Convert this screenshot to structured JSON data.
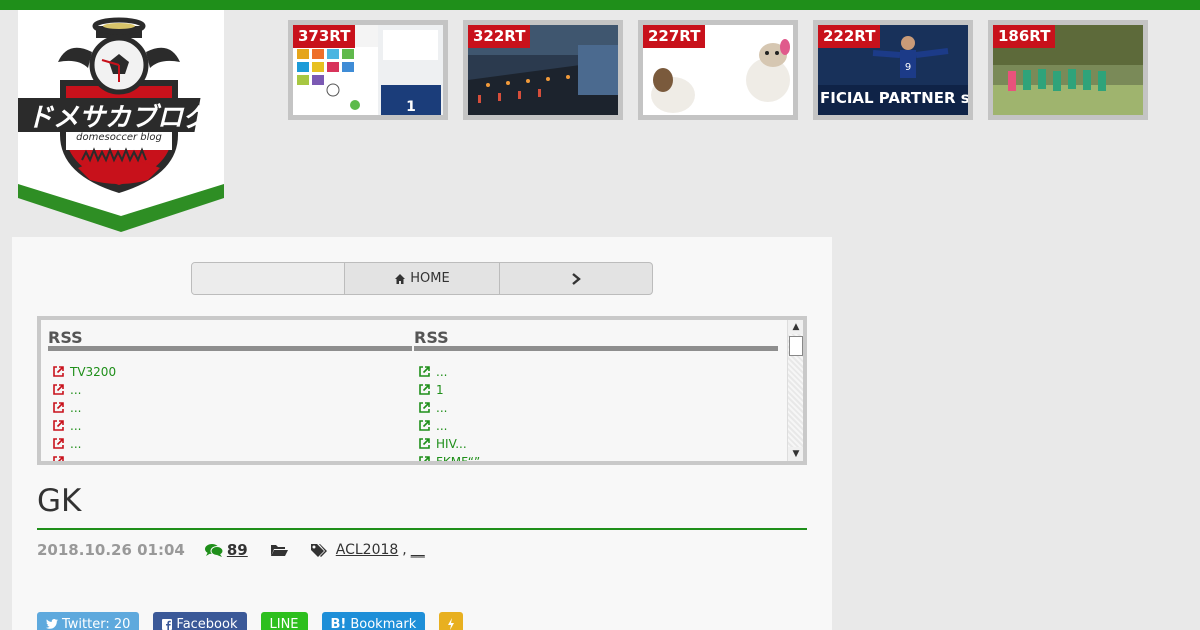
{
  "brand": {
    "logo_text": "ドメサカブログ",
    "logo_subtext": "domesoccer blog",
    "colors": {
      "topbar": "#1f8f1a",
      "red": "#c8111b",
      "green": "#1f8f1a"
    }
  },
  "popular": [
    {
      "badge": "373RT",
      "alt": "chat-screenshot"
    },
    {
      "badge": "322RT",
      "alt": "night-road"
    },
    {
      "badge": "227RT",
      "alt": "animal-figures"
    },
    {
      "badge": "222RT",
      "alt": "soccer-player",
      "overlay": "FICIAL PARTNER sin"
    },
    {
      "badge": "186RT",
      "alt": "team-photo"
    }
  ],
  "nav": {
    "home_label": "HOME",
    "home_icon": "home-icon",
    "next_icon": "chevron-right-icon"
  },
  "rss": {
    "col1": {
      "header": "RSS",
      "items": [
        "TV3200",
        "...",
        "...",
        "...",
        "...",
        "..."
      ]
    },
    "col2": {
      "header": "RSS",
      "items": [
        "...",
        "1",
        "...",
        "...",
        "HIV...",
        "FKMF“”"
      ]
    }
  },
  "post": {
    "title": "GK",
    "date": "2018.10.26 01:04",
    "comments": "89",
    "tags": [
      "ACL2018",
      "__"
    ]
  },
  "share": {
    "twitter": "Twitter: 20",
    "facebook": "Facebook",
    "line": "LINE",
    "hatena": "Bookmark"
  }
}
